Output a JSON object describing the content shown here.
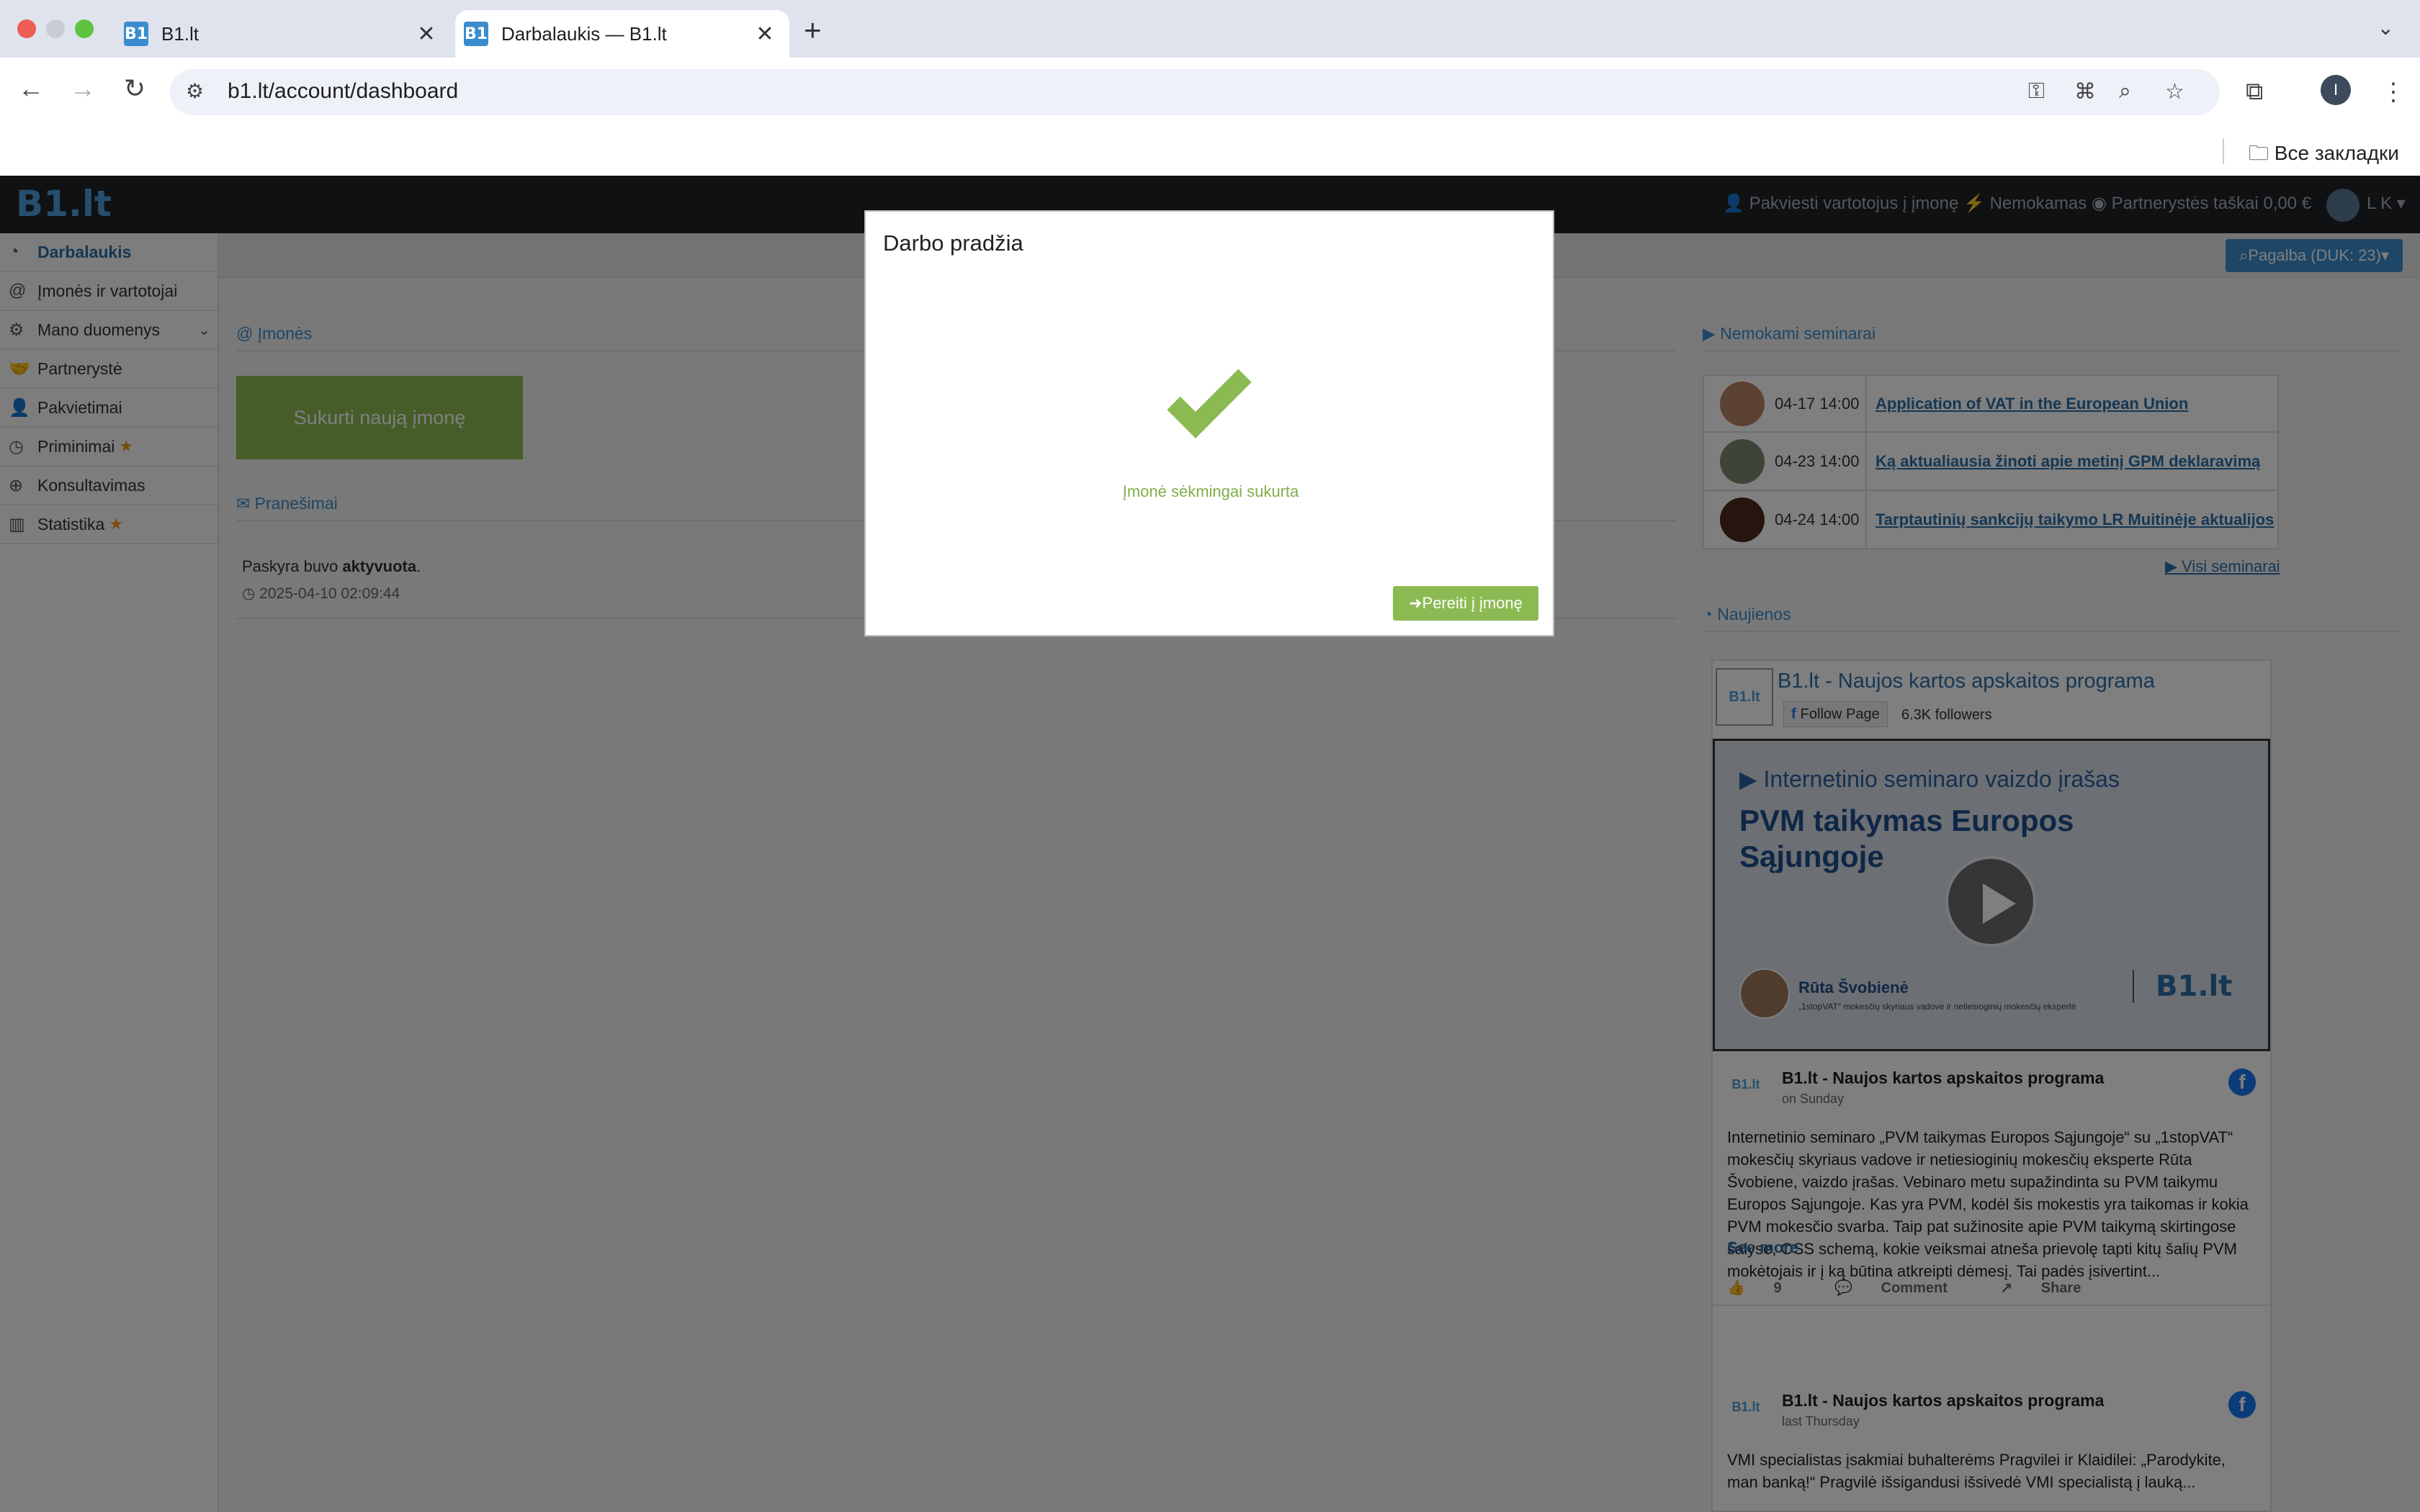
{
  "browser": {
    "tabs": [
      {
        "title": "B1.lt",
        "favicon": "B1"
      },
      {
        "title": "Darbalaukis — B1.lt",
        "favicon": "B1"
      }
    ],
    "url": "b1.lt/account/dashboard",
    "bookmarks_folder": "Все закладки",
    "profile_initial": "I"
  },
  "topnav": {
    "logo": "B1.lt",
    "invite": "Pakviesti vartotojus į įmonę",
    "plan": "Nemokamas",
    "partner_points": "Partnerystės taškai 0,00 €",
    "user": "L K"
  },
  "sidebar": {
    "items": [
      {
        "label": "Darbalaukis",
        "icon": "dashboard-icon"
      },
      {
        "label": "Įmonės ir vartotojai",
        "icon": "at-icon"
      },
      {
        "label": "Mano duomenys",
        "icon": "cogs-icon"
      },
      {
        "label": "Partnerystė",
        "icon": "handshake-icon"
      },
      {
        "label": "Pakvietimai",
        "icon": "user-plus-icon"
      },
      {
        "label": "Priminimai",
        "icon": "clock-icon"
      },
      {
        "label": "Konsultavimas",
        "icon": "globe-icon"
      },
      {
        "label": "Statistika",
        "icon": "bar-chart-icon"
      }
    ]
  },
  "help_button": "Pagalba (DUK: 23)",
  "companies": {
    "heading": "Įmonės",
    "create_button": "Sukurti naują įmonę"
  },
  "notices": {
    "heading": "Pranešimai",
    "text_prefix": "Paskyra buvo ",
    "text_bold": "aktyvuota",
    "text_suffix": ".",
    "date": "2025-04-10 02:09:44"
  },
  "seminars": {
    "heading": "Nemokami seminarai",
    "rows": [
      {
        "date": "04-17 14:00",
        "title": "Application of VAT in the European Union"
      },
      {
        "date": "04-23 14:00",
        "title": "Ką aktualiausia žinoti apie metinį GPM deklaravimą"
      },
      {
        "date": "04-24 14:00",
        "title": "Tarptautinių sankcijų taikymo LR Muitinėje aktualijos"
      }
    ],
    "all_link": "Visi seminarai"
  },
  "news": {
    "heading": "Naujienos",
    "page_title": "B1.lt - Naujos kartos apskaitos programa",
    "follow": "Follow Page",
    "followers": "6.3K followers",
    "video": {
      "caption": "Internetinio seminaro vaizdo įrašas",
      "title": "PVM taikymas Europos Sąjungoje",
      "speaker": "Rūta Švobienė",
      "speaker_role": "„1stopVAT“ mokesčių skyriaus vadovė ir netiesioginių mokesčių ekspertė",
      "logo": "B1.lt"
    },
    "posts": [
      {
        "name": "B1.lt - Naujos kartos apskaitos programa",
        "time": "on Sunday",
        "text": "Internetinio seminaro „PVM taikymas Europos Sąjungoje“ su „1stopVAT“ mokesčių skyriaus vadove ir netiesioginių mokesčių eksperte Rūta Švobiene, vaizdo įrašas. Vebinaro metu supažindinta su PVM taikymu Europos Sąjungoje. Kas yra PVM, kodėl šis mokestis yra taikomas ir kokia PVM mokesčio svarba. Taip pat sužinosite apie PVM taikymą skirtingose šalyse, OSS schemą, kokie veiksmai atneša prievolę tapti kitų šalių PVM mokėtojais ir į ką būtina atkreipti dėmesį. Tai padės įsivertint...",
        "see_more": "See more",
        "likes": "9",
        "comment": "Comment",
        "share": "Share"
      },
      {
        "name": "B1.lt - Naujos kartos apskaitos programa",
        "time": "last Thursday",
        "text": "VMI specialistas įsakmiai buhalterėms Pragvilei ir Klaidilei: „Parodykite, man banką!“ Pragvilė išsigandusi išsivedė VMI specialistą į lauką..."
      }
    ]
  },
  "modal": {
    "title": "Darbo pradžia",
    "message": "Įmonė sėkmingai sukurta",
    "button": "Pereiti į įmonę"
  }
}
